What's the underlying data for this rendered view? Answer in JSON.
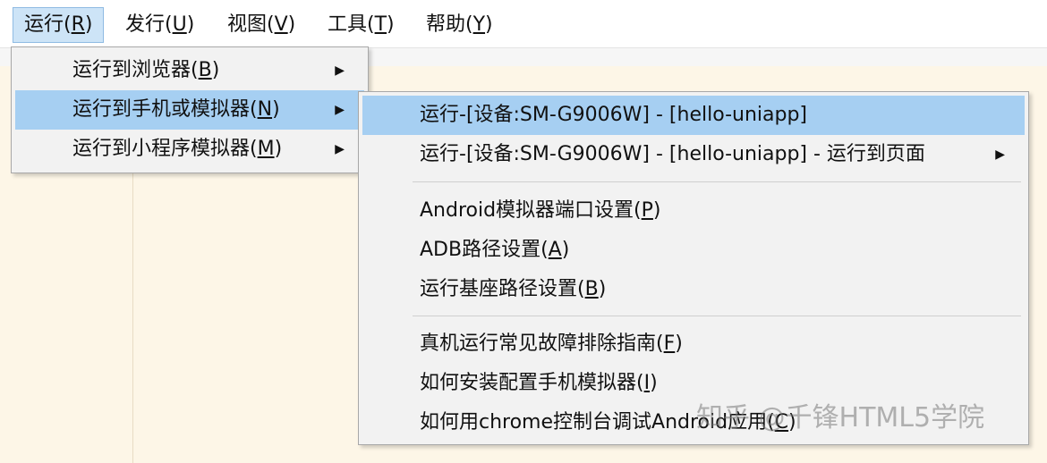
{
  "menubar": {
    "items": [
      {
        "label": "运行(",
        "key": "R",
        "tail": ")"
      },
      {
        "label": "发行(",
        "key": "U",
        "tail": ")"
      },
      {
        "label": "视图(",
        "key": "V",
        "tail": ")"
      },
      {
        "label": "工具(",
        "key": "T",
        "tail": ")"
      },
      {
        "label": "帮助(",
        "key": "Y",
        "tail": ")"
      }
    ]
  },
  "run_menu": {
    "items": [
      {
        "label": "运行到浏览器(",
        "key": "B",
        "tail": ")",
        "arrow": "▶"
      },
      {
        "label": "运行到手机或模拟器(",
        "key": "N",
        "tail": ")",
        "arrow": "▶"
      },
      {
        "label": "运行到小程序模拟器(",
        "key": "M",
        "tail": ")",
        "arrow": "▶"
      }
    ]
  },
  "device_submenu": {
    "items": [
      {
        "label": "运行-[设备:SM-G9006W] - [hello-uniapp]"
      },
      {
        "label": "运行-[设备:SM-G9006W] - [hello-uniapp] - 运行到页面",
        "arrow": "▶"
      },
      {
        "label": "Android模拟器端口设置(",
        "key": "P",
        "tail": ")"
      },
      {
        "label": "ADB路径设置(",
        "key": "A",
        "tail": ")"
      },
      {
        "label": "运行基座路径设置(",
        "key": "B",
        "tail": ")"
      },
      {
        "label": "真机运行常见故障排除指南(",
        "key": "F",
        "tail": ")"
      },
      {
        "label": "如何安装配置手机模拟器(",
        "key": "I",
        "tail": ")"
      },
      {
        "label": "如何用chrome控制台调试Android应用(",
        "key": "C",
        "tail": ")"
      }
    ]
  },
  "watermark": "知乎 @千锋HTML5学院"
}
